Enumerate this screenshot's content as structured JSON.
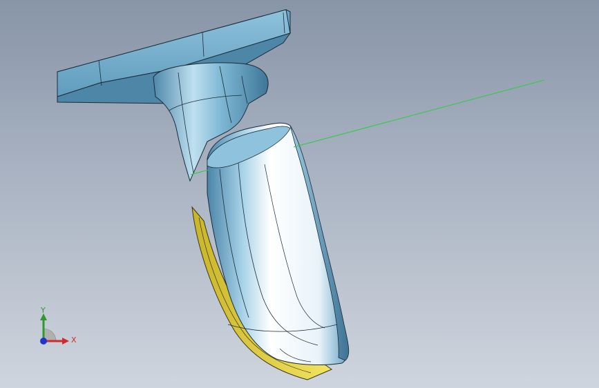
{
  "viewport": {
    "background_top": "#8895a8",
    "background_bottom": "#cfd5de"
  },
  "model": {
    "body_color": "#6fa9c9",
    "highlight_color": "#ffffff",
    "edge_color": "#000000",
    "seal_color": "#e8d84a",
    "guide_line_color": "#2ecc40"
  },
  "triad": {
    "y_label": "Y",
    "x_label": "X",
    "y_color": "#2e9a2e",
    "x_color": "#d02a2a",
    "z_color": "#2233cc"
  }
}
